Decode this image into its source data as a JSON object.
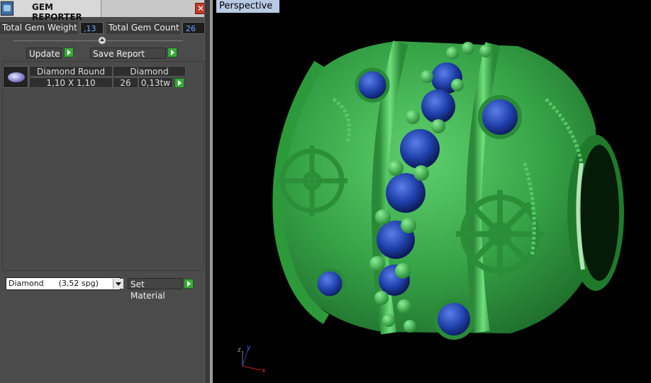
{
  "window": {
    "title": "GEM REPORTER",
    "close_glyph": "✕"
  },
  "summary": {
    "weight_label": "Total Gem Weight",
    "weight_value": ",13",
    "count_label": "Total Gem Count",
    "count_value": "26"
  },
  "actions": {
    "update_label": "Update",
    "save_report_label": "Save Report",
    "set_material_label": "Set Material"
  },
  "gem_table": {
    "headers": [
      "Diamond Round",
      "Diamond"
    ],
    "rows": [
      {
        "size": "1,10 X 1,10",
        "count": "26",
        "weight": "0,13tw"
      }
    ]
  },
  "material_select": {
    "value": "Diamond      (3,52 spg)"
  },
  "viewport": {
    "label": "Perspective",
    "axis": {
      "x": "x",
      "y": "y",
      "z": "z"
    }
  },
  "colors": {
    "model_green": "#3fb14f",
    "gem_blue": "#1e3fa8",
    "panel_bg": "#4b4b4b",
    "accent_green": "#3aa93a"
  },
  "icons": [
    "gem-reporter-icon",
    "close-icon",
    "collapse-icon",
    "play-arrow-icon",
    "dropdown-arrow-icon",
    "axis-gizmo-icon"
  ]
}
